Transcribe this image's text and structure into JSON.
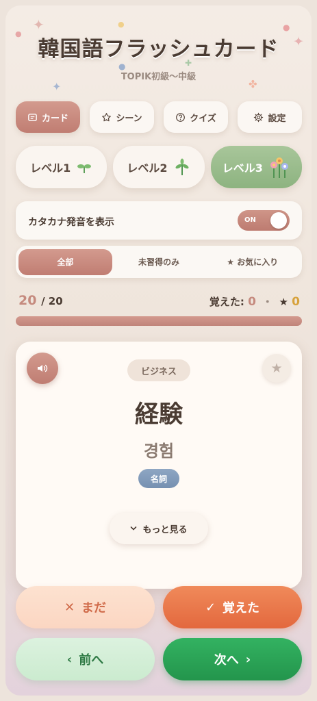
{
  "app": {
    "title": "韓国語フラッシュカード",
    "subtitle": "TOPIK初級〜中級"
  },
  "tabs": [
    {
      "label": "カード",
      "icon": "card-icon",
      "active": true
    },
    {
      "label": "シーン",
      "icon": "star-outline-icon",
      "active": false
    },
    {
      "label": "クイズ",
      "icon": "question-circle-icon",
      "active": false
    },
    {
      "label": "設定",
      "icon": "gear-icon",
      "active": false
    }
  ],
  "levels": [
    {
      "label": "レベル1",
      "icon": "sprout-icon",
      "active": false
    },
    {
      "label": "レベル2",
      "icon": "seedling-icon",
      "active": false
    },
    {
      "label": "レベル3",
      "icon": "flowers-icon",
      "active": true
    }
  ],
  "katakana_toggle": {
    "label": "カタカナ発音を表示",
    "state": "ON"
  },
  "filters": [
    {
      "label": "全部",
      "active": true
    },
    {
      "label": "未習得のみ",
      "active": false
    },
    {
      "label": "★ お気に入り",
      "active": false
    }
  ],
  "progress": {
    "current": "20",
    "total": "/ 20",
    "fraction": 1.0
  },
  "stats": {
    "learned_label": "覚えた:",
    "learned_count": "0",
    "separator": "・",
    "star": "★",
    "fav_count": "0"
  },
  "card": {
    "category": "ビジネス",
    "word": "経験",
    "korean": "경험",
    "part_of_speech": "名詞",
    "more_label": "もっと見る",
    "star": "★"
  },
  "actions": {
    "not_yet": "まだ",
    "learned": "覚えた",
    "prev": "前へ",
    "next": "次へ"
  },
  "colors": {
    "accent": "#c58a7e",
    "level_active": "#9bbd8d",
    "learned_btn": "#e8714a",
    "next_btn": "#2aa257"
  }
}
